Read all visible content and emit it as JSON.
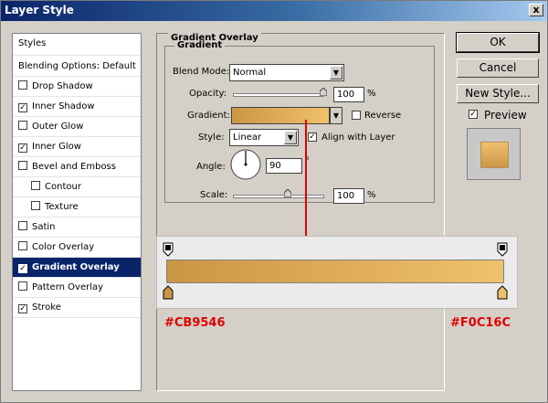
{
  "window": {
    "title": "Layer Style",
    "close_glyph": "x"
  },
  "styles": [
    {
      "label": "Styles",
      "checkbox": false,
      "checked": false,
      "selected": false,
      "indent": false
    },
    {
      "label": "Blending Options: Default",
      "checkbox": false,
      "checked": false,
      "selected": false,
      "indent": false
    },
    {
      "label": "Drop Shadow",
      "checkbox": true,
      "checked": false,
      "selected": false,
      "indent": false
    },
    {
      "label": "Inner Shadow",
      "checkbox": true,
      "checked": true,
      "selected": false,
      "indent": false
    },
    {
      "label": "Outer Glow",
      "checkbox": true,
      "checked": false,
      "selected": false,
      "indent": false
    },
    {
      "label": "Inner Glow",
      "checkbox": true,
      "checked": true,
      "selected": false,
      "indent": false
    },
    {
      "label": "Bevel and Emboss",
      "checkbox": true,
      "checked": false,
      "selected": false,
      "indent": false
    },
    {
      "label": "Contour",
      "checkbox": true,
      "checked": false,
      "selected": false,
      "indent": true
    },
    {
      "label": "Texture",
      "checkbox": true,
      "checked": false,
      "selected": false,
      "indent": true
    },
    {
      "label": "Satin",
      "checkbox": true,
      "checked": false,
      "selected": false,
      "indent": false
    },
    {
      "label": "Color Overlay",
      "checkbox": true,
      "checked": false,
      "selected": false,
      "indent": false
    },
    {
      "label": "Gradient Overlay",
      "checkbox": true,
      "checked": true,
      "selected": true,
      "indent": false
    },
    {
      "label": "Pattern Overlay",
      "checkbox": true,
      "checked": false,
      "selected": false,
      "indent": false
    },
    {
      "label": "Stroke",
      "checkbox": true,
      "checked": true,
      "selected": false,
      "indent": false
    }
  ],
  "panel": {
    "section_title": "Gradient Overlay",
    "group_title": "Gradient",
    "blend_mode_label": "Blend Mode:",
    "blend_mode_value": "Normal",
    "opacity_label": "Opacity:",
    "opacity_value": "100",
    "opacity_level": 1.0,
    "percent": "%",
    "gradient_label": "Gradient:",
    "reverse_label": "Reverse",
    "reverse_checked": false,
    "style_label": "Style:",
    "style_value": "Linear",
    "align_label": "Align with Layer",
    "align_checked": true,
    "angle_label": "Angle:",
    "angle_value": "90",
    "angle_unit": "°",
    "scale_label": "Scale:",
    "scale_value": "100",
    "scale_level": 0.6
  },
  "buttons": {
    "ok": "OK",
    "cancel": "Cancel",
    "new_style": "New Style...",
    "preview_label": "Preview",
    "preview_checked": true
  },
  "gradient": {
    "start_color": "#CB9546",
    "end_color": "#F0C16C",
    "start_label": "#CB9546",
    "end_label": "#F0C16C"
  },
  "icons": {
    "checkmark": "✓",
    "dropdown": "▼"
  }
}
